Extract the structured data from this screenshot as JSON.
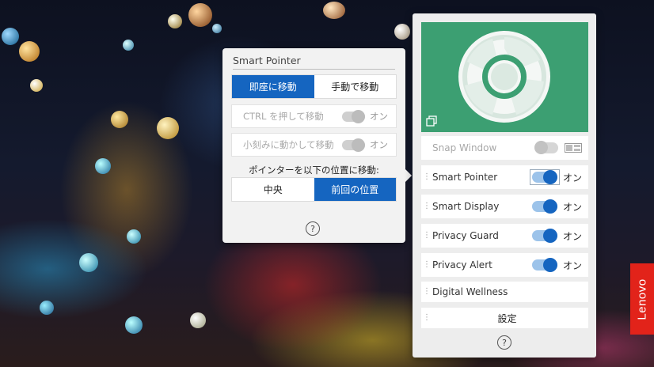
{
  "smart_pointer_flyout": {
    "title": "Smart Pointer",
    "mode_tabs": [
      {
        "label": "即座に移動",
        "active": true
      },
      {
        "label": "手動で移動",
        "active": false
      }
    ],
    "options": [
      {
        "label": "CTRL を押して移動",
        "state": "オン",
        "enabled": false
      },
      {
        "label": "小刻みに動かして移動",
        "state": "オン",
        "enabled": false
      }
    ],
    "move_to_label": "ポインターを以下の位置に移動:",
    "position_tabs": [
      {
        "label": "中央",
        "active": false
      },
      {
        "label": "前回の位置",
        "active": true
      }
    ],
    "help_icon": "?"
  },
  "main_panel": {
    "hero_color": "#3c9f72",
    "snap_window": {
      "label": "Snap Window",
      "enabled": false
    },
    "features": [
      {
        "label": "Smart Pointer",
        "state": "オン",
        "on": true
      },
      {
        "label": "Smart Display",
        "state": "オン",
        "on": true
      },
      {
        "label": "Privacy Guard",
        "state": "オン",
        "on": true
      },
      {
        "label": "Privacy Alert",
        "state": "オン",
        "on": true
      }
    ],
    "digital_wellness": {
      "label": "Digital Wellness"
    },
    "settings": {
      "label": "設定"
    },
    "help_icon": "?"
  },
  "brand": {
    "name": "Lenovo",
    "color": "#e2231a"
  },
  "accent_color": "#1565c0"
}
